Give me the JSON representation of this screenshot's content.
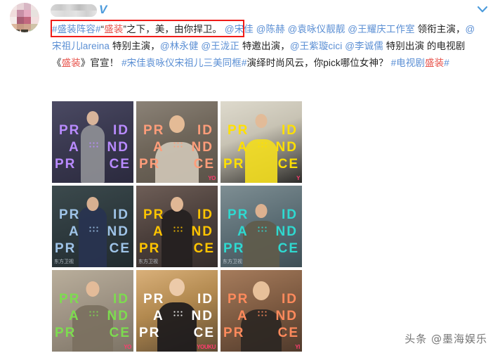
{
  "header": {
    "avatar_alt": "user-avatar-blurred",
    "username": "",
    "verified_badge": "V",
    "collapse_icon": "chevron-down-icon"
  },
  "post": {
    "highlight_box_color": "#ef1c18",
    "link_color": "#5b8fd4",
    "hashtag_red_color": "#e8554e",
    "segments": [
      {
        "text": "#盛装阵容#",
        "style": "tag-blue"
      },
      {
        "text": "“",
        "style": "plain"
      },
      {
        "text": "盛装",
        "style": "tag-red"
      },
      {
        "text": "”之下，美，由你捍卫。",
        "style": "plain"
      },
      {
        "text": " @宋佳",
        "style": "link"
      },
      {
        "text": " @陈赫",
        "style": "link"
      },
      {
        "text": " @袁咏仪靓靓",
        "style": "link"
      },
      {
        "text": " @王耀庆工作室",
        "style": "link"
      },
      {
        "text": " 领衔主演，",
        "style": "plain"
      },
      {
        "text": "@宋祖儿lareina",
        "style": "link"
      },
      {
        "text": " 特别主演，",
        "style": "plain"
      },
      {
        "text": "@林永健",
        "style": "link"
      },
      {
        "text": " ",
        "style": "plain"
      },
      {
        "text": "@王泷正",
        "style": "link"
      },
      {
        "text": " 特邀出演，",
        "style": "plain"
      },
      {
        "text": "@王紫璇cici",
        "style": "link"
      },
      {
        "text": "  ",
        "style": "plain"
      },
      {
        "text": "@李诚儒",
        "style": "link"
      },
      {
        "text": " 特别出演 的电视剧《",
        "style": "plain"
      },
      {
        "text": "盛装",
        "style": "tag-red"
      },
      {
        "text": "》官宣！ ",
        "style": "plain"
      },
      {
        "text": "#宋佳袁咏仪宋祖儿三美同框#",
        "style": "tag-blue"
      },
      {
        "text": "演绎时尚风云，你pick哪位女神？ ",
        "style": "plain"
      },
      {
        "text": "#电视剧",
        "style": "tag-blue"
      },
      {
        "text": "盛装",
        "style": "tag-red"
      },
      {
        "text": "#",
        "style": "tag-blue"
      }
    ]
  },
  "gallery": {
    "columns": 3,
    "rows": 3,
    "items": [
      {
        "id": "photo-1",
        "caption": "woman-in-grey-coat-office",
        "overlay_color": "#b98bff",
        "bg": "linear-gradient(160deg,#4b4a63 0%,#3a3950 45%,#2b2a3e 100%)",
        "watermark": "",
        "badge_cn": ""
      },
      {
        "id": "photo-2",
        "caption": "man-in-straw-hat-desk",
        "overlay_color": "#ff9d7a",
        "bg": "linear-gradient(160deg,#8b8277 0%,#6e6559 48%,#5a5248 100%)",
        "watermark": "YO",
        "badge_cn": ""
      },
      {
        "id": "photo-3",
        "caption": "woman-in-yellow-sitting-sofa",
        "overlay_color": "#ffe000",
        "bg": "linear-gradient(160deg,#dedacd 0%,#c8c3b4 40%,#2b2a28 100%)",
        "watermark": "Y",
        "badge_cn": ""
      },
      {
        "id": "photo-4",
        "caption": "man-in-navy-suit-stairs",
        "overlay_color": "#9fc4e8",
        "bg": "linear-gradient(160deg,#3c4a4d 0%,#2d393d 50%,#222b2f 100%)",
        "watermark": "",
        "badge_cn": "东方卫视"
      },
      {
        "id": "photo-5",
        "caption": "woman-with-folder-magazine-wall",
        "overlay_color": "#ffc400",
        "bg": "linear-gradient(160deg,#6e5e57 0%,#4b3f3b 50%,#352d2b 100%)",
        "watermark": "",
        "badge_cn": "东方卫视"
      },
      {
        "id": "photo-6",
        "caption": "man-in-chair-outdoor",
        "overlay_color": "#2fd9d0",
        "bg": "linear-gradient(160deg,#7e8e93 0%,#5b6d74 50%,#3f4f56 100%)",
        "watermark": "",
        "badge_cn": "东方卫视"
      },
      {
        "id": "photo-7",
        "caption": "man-at-table-with-oranges",
        "overlay_color": "#7ddc4f",
        "bg": "linear-gradient(160deg,#b9ae9b 0%,#9c9182 50%,#7c7365 100%)",
        "watermark": "YO",
        "badge_cn": ""
      },
      {
        "id": "photo-8",
        "caption": "woman-in-black-jacket-cafe",
        "overlay_color": "#ffffff",
        "bg": "linear-gradient(160deg,#d9b07a 0%,#b2894f 45%,#5e4b34 100%)",
        "watermark": "YOUKU",
        "badge_cn": ""
      },
      {
        "id": "photo-9",
        "caption": "elder-man-with-bowtie-mirror",
        "overlay_color": "#ff8a5c",
        "bg": "linear-gradient(160deg,#a67c5c 0%,#7d5a41 50%,#4f3a2c 100%)",
        "watermark": "YI",
        "badge_cn": ""
      }
    ],
    "overlay_lines": {
      "line1_left": "PR",
      "line1_right": "ID",
      "line2_left": "A",
      "line2_right": "ND",
      "line3_left": "PR",
      "line3_right": "CE"
    }
  },
  "watermark": {
    "text": "头条 @墨海娱乐"
  }
}
